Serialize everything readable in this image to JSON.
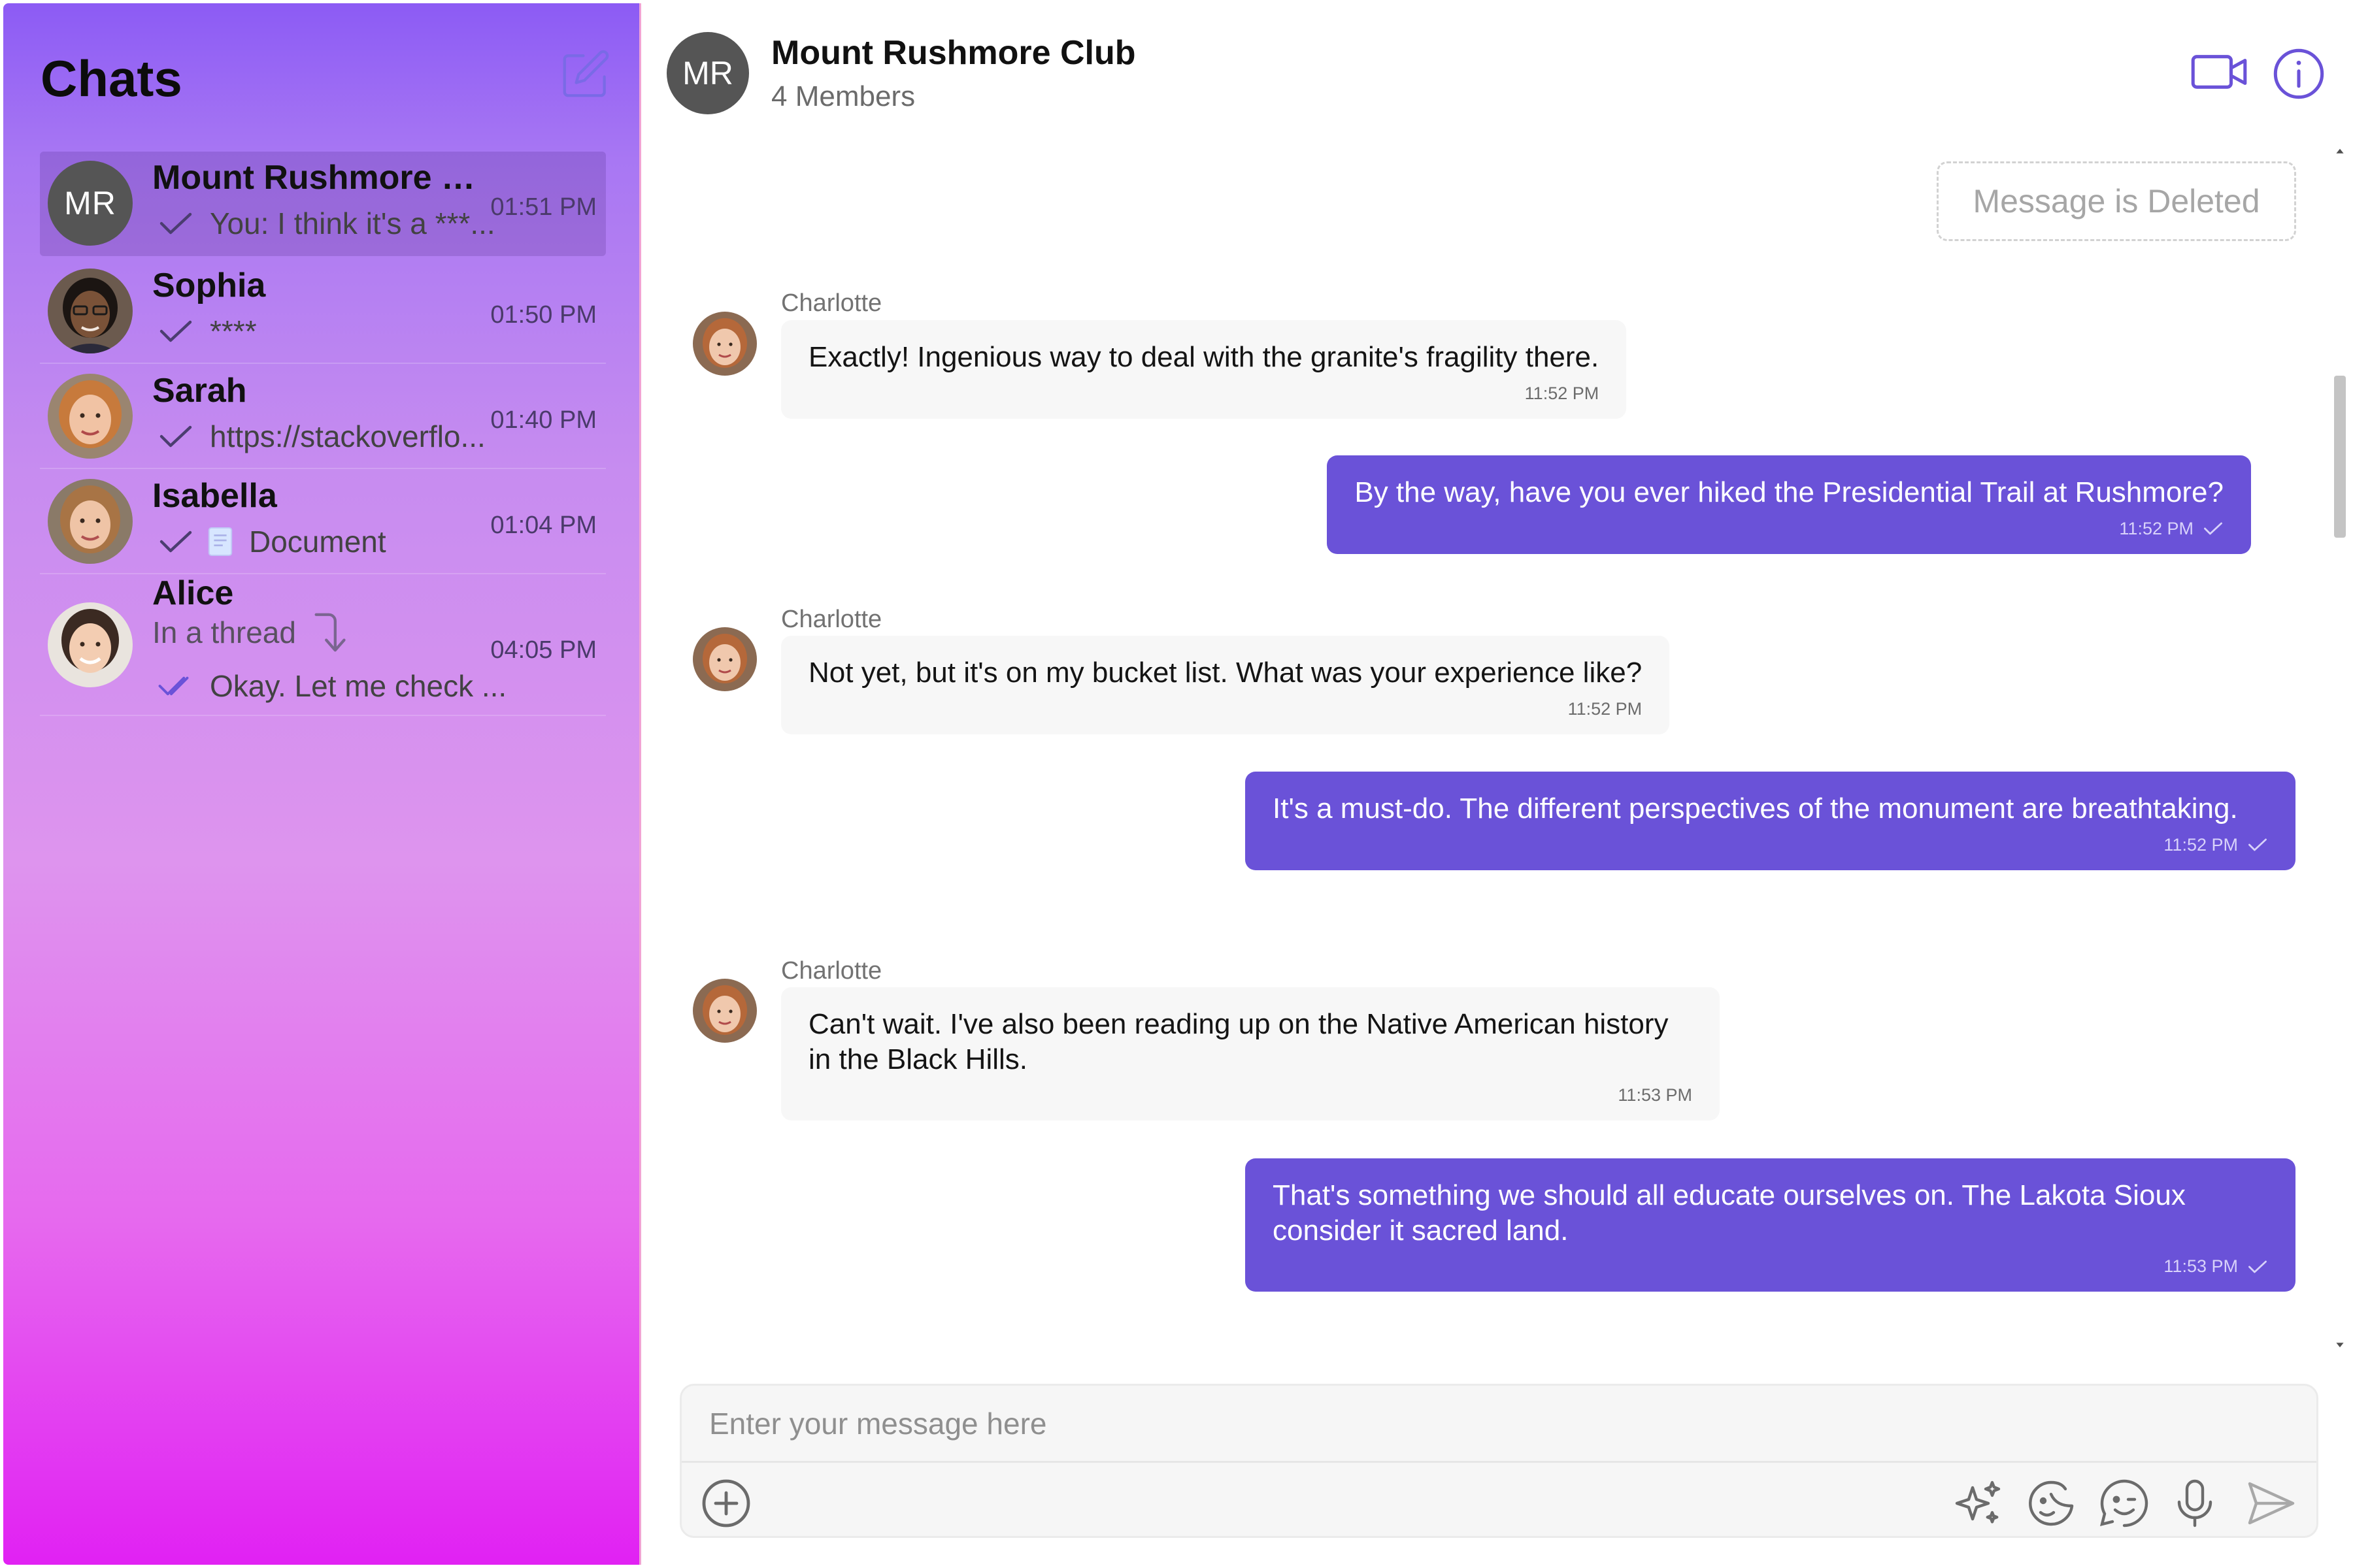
{
  "sidebar": {
    "title": "Chats",
    "compose_icon": "edit-icon",
    "conversations": [
      {
        "name": "Mount Rushmore Club",
        "initials": "MR",
        "preview": "You: I think it's a ***...",
        "time": "01:51 PM",
        "receipt": "sent"
      },
      {
        "name": "Sophia",
        "preview": "****",
        "time": "01:50 PM",
        "receipt": "sent"
      },
      {
        "name": "Sarah",
        "preview": "https://stackoverflo...",
        "time": "01:40 PM",
        "receipt": "sent"
      },
      {
        "name": "Isabella",
        "preview": "Document",
        "time": "01:04 PM",
        "receipt": "sent",
        "preview_icon": "document-icon"
      },
      {
        "name": "Alice",
        "thread_label": "In a thread",
        "preview": "Okay. Let me check ...",
        "time": "04:05 PM",
        "receipt": "read"
      }
    ]
  },
  "header": {
    "initials": "MR",
    "title": "Mount Rushmore Club",
    "subtitle": "4 Members",
    "icons": [
      "video-call-icon",
      "info-icon"
    ]
  },
  "messages": {
    "deleted": "Message is Deleted",
    "items": [
      {
        "direction": "in",
        "sender": "Charlotte",
        "text": "Exactly! Ingenious way to deal with the granite's fragility there.",
        "time": "11:52 PM"
      },
      {
        "direction": "out",
        "text": "By the way, have you ever hiked the Presidential Trail at Rushmore?",
        "time": "11:52 PM"
      },
      {
        "direction": "in",
        "sender": "Charlotte",
        "text": "Not yet, but it's on my bucket list. What was your experience like?",
        "time": "11:52 PM"
      },
      {
        "direction": "out",
        "text": "It's a must-do. The different perspectives of the monument are breathtaking.",
        "time": "11:52 PM"
      },
      {
        "direction": "in",
        "sender": "Charlotte",
        "text": "Can't wait. I've also been reading up on the Native American history in the Black Hills.",
        "time": "11:53 PM"
      },
      {
        "direction": "out",
        "text": "That's something we should all educate ourselves on. The Lakota Sioux consider it sacred land.",
        "time": "11:53 PM"
      }
    ]
  },
  "composer": {
    "placeholder": "Enter your message here",
    "icons": [
      "add-icon",
      "ai-sparkle-icon",
      "sticker-icon",
      "emoji-icon",
      "microphone-icon",
      "send-icon"
    ]
  },
  "colors": {
    "accent": "#6a52d8",
    "sidebar_gradient_top": "#8c5bf4",
    "sidebar_gradient_bottom": "#e121f3"
  }
}
